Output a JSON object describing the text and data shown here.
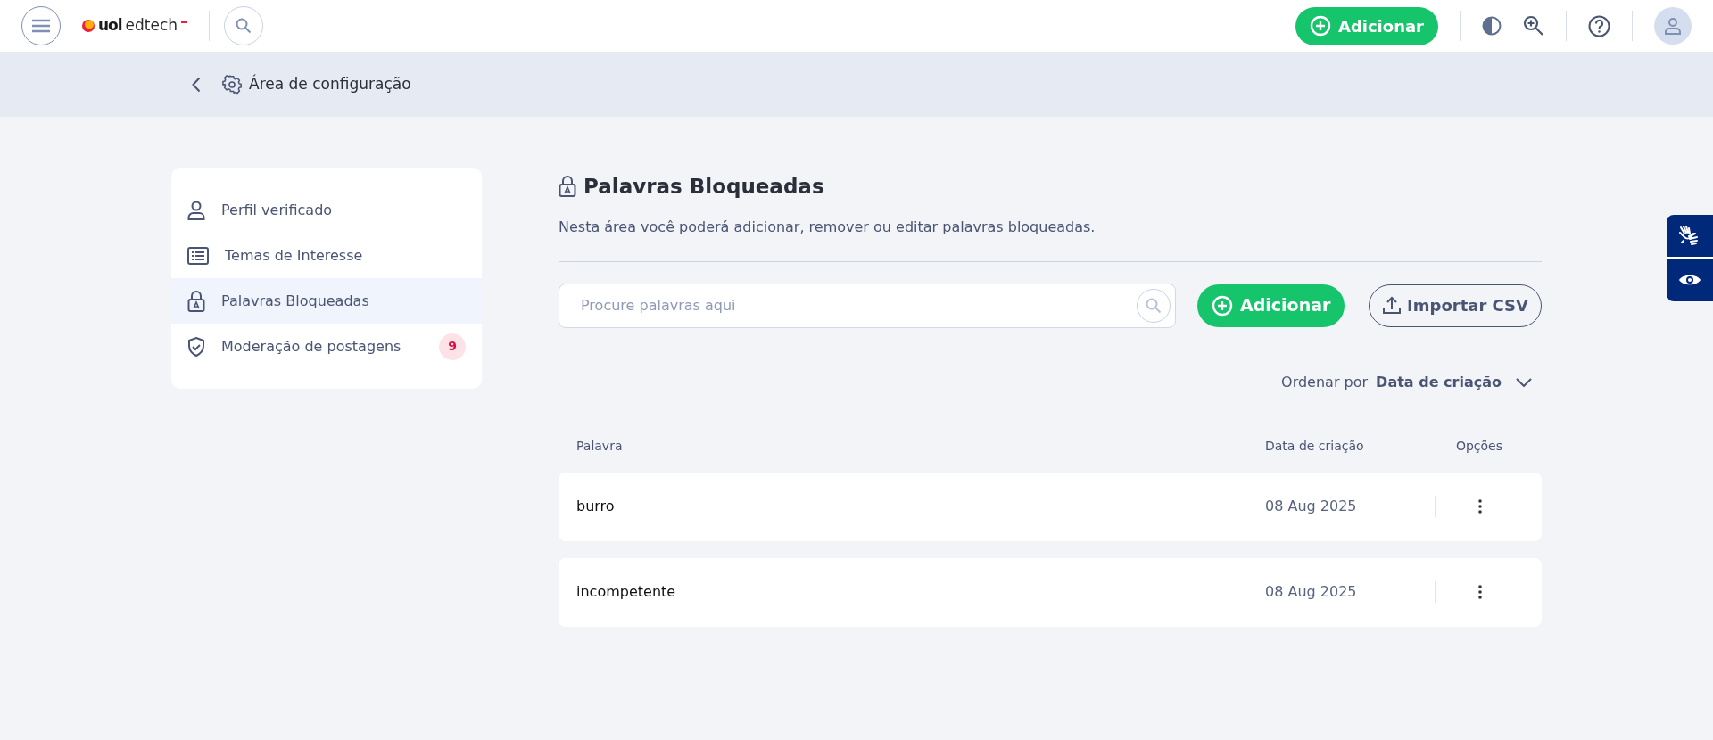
{
  "header": {
    "logo": {
      "brand": "uol",
      "product": "edtech"
    },
    "add_button": "Adicionar"
  },
  "breadcrumb": {
    "title": "Área de configuração"
  },
  "sidebar": {
    "items": [
      {
        "label": "Perfil verificado",
        "selected": false
      },
      {
        "label": "Temas de Interesse",
        "selected": false
      },
      {
        "label": "Palavras Bloqueadas",
        "selected": true
      },
      {
        "label": "Moderação de postagens",
        "selected": false,
        "badge": "9"
      }
    ]
  },
  "main": {
    "title": "Palavras Bloqueadas",
    "description": "Nesta área você poderá adicionar, remover ou editar palavras bloqueadas.",
    "search": {
      "placeholder": "Procure palavras aqui"
    },
    "add_button": "Adicionar",
    "import_button": "Importar CSV",
    "sort": {
      "label": "Ordenar por",
      "value": "Data de criação"
    },
    "table": {
      "columns": [
        "Palavra",
        "Data de criação",
        "Opções"
      ],
      "rows": [
        {
          "word": "burro",
          "date": "08 Aug 2025"
        },
        {
          "word": "incompetente",
          "date": "08 Aug 2025"
        }
      ]
    }
  }
}
